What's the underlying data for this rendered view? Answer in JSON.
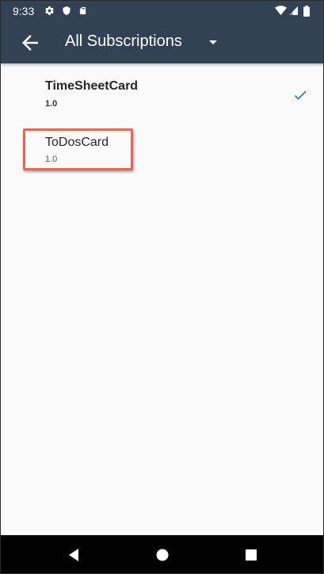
{
  "status_bar": {
    "time": "9:33",
    "icons": [
      "settings-icon",
      "shield-icon",
      "sd-card-icon",
      "wifi-icon",
      "signal-icon",
      "battery-icon"
    ]
  },
  "app_bar": {
    "title": "All Subscriptions",
    "back_icon": "arrow-back-icon",
    "dropdown_icon": "arrow-drop-down-icon",
    "background_color": "#324154"
  },
  "subscriptions": [
    {
      "name": "TimeSheetCard",
      "version": "1.0",
      "selected": true
    },
    {
      "name": "ToDosCard",
      "version": "1.0",
      "selected": false,
      "highlighted": true
    }
  ],
  "colors": {
    "accent": "#1976d2",
    "highlight": "#e0675a"
  },
  "nav_bar": {
    "buttons": [
      "back-triangle-icon",
      "home-circle-icon",
      "recents-square-icon"
    ]
  }
}
